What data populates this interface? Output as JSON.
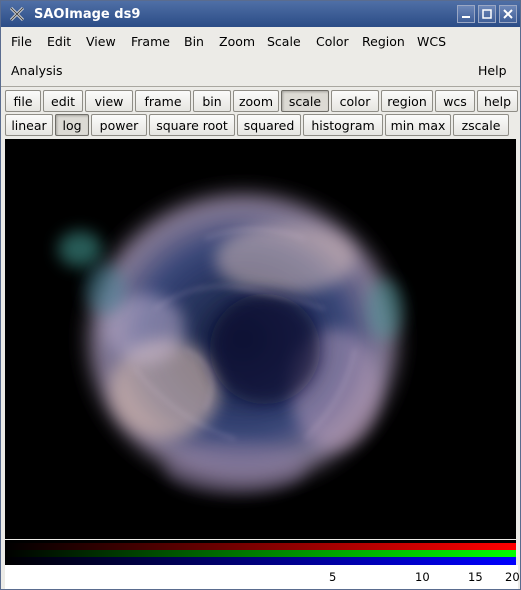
{
  "window": {
    "title": "SAOImage ds9"
  },
  "menubar": {
    "items": [
      "File",
      "Edit",
      "View",
      "Frame",
      "Bin",
      "Zoom",
      "Scale",
      "Color",
      "Region",
      "WCS"
    ],
    "analysis": "Analysis",
    "help": "Help"
  },
  "buttonbar": {
    "top": [
      "file",
      "edit",
      "view",
      "frame",
      "bin",
      "zoom",
      "scale",
      "color",
      "region",
      "wcs",
      "help"
    ],
    "active_top": "scale",
    "scale_options": [
      "linear",
      "log",
      "power",
      "square root",
      "squared",
      "histogram",
      "min max",
      "zscale"
    ],
    "active_scale": "log"
  },
  "colorbar": {
    "tick_labels": [
      "5",
      "10",
      "15",
      "20"
    ],
    "channels": {
      "red": "#ff0000",
      "green": "#00ff00",
      "blue": "#0000ff"
    }
  }
}
